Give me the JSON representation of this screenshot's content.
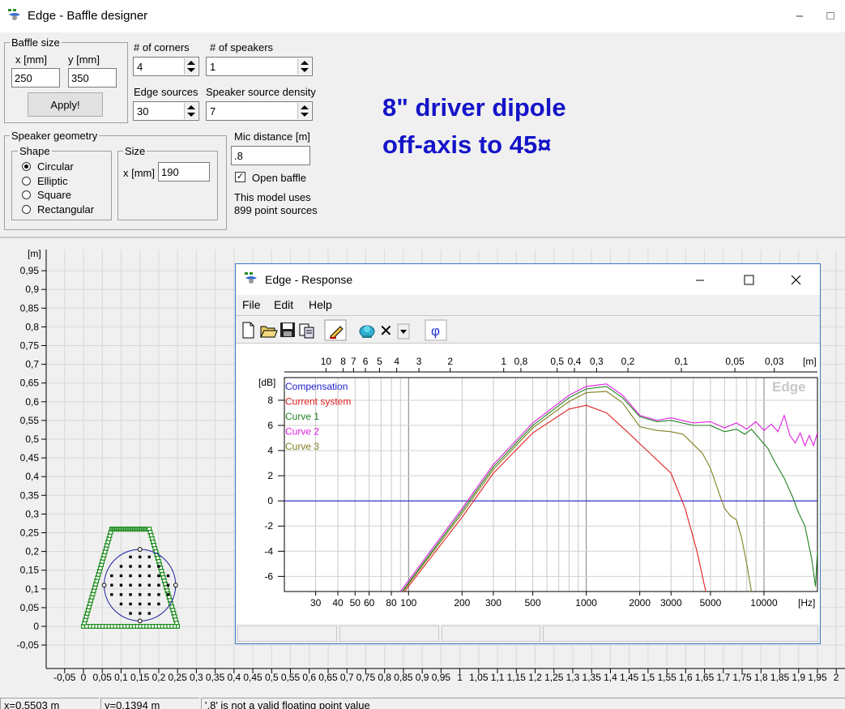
{
  "window": {
    "title": "Edge - Baffle designer",
    "min": "–",
    "max": "□"
  },
  "baffle": {
    "group": "Baffle size",
    "x_label": "x [mm]",
    "y_label": "y [mm]",
    "x_value": "250",
    "y_value": "350",
    "apply": "Apply!"
  },
  "corners": {
    "label": "# of corners",
    "value": "4"
  },
  "speakers": {
    "label": "# of speakers",
    "value": "1"
  },
  "edge_sources": {
    "label": "Edge sources",
    "value": "30"
  },
  "density": {
    "label": "Speaker source density",
    "value": "7"
  },
  "geometry": {
    "group": "Speaker geometry",
    "shape_group": "Shape",
    "shapes": [
      "Circular",
      "Elliptic",
      "Square",
      "Rectangular"
    ],
    "selected": 0,
    "size_group": "Size",
    "size_label": "x [mm]",
    "size_value": "190"
  },
  "mic": {
    "label": "Mic distance [m]",
    "value": ".8"
  },
  "open_baffle": {
    "label": "Open baffle",
    "checked": true
  },
  "model_info": {
    "line1": "This model uses",
    "line2": "899 point sources"
  },
  "banner": {
    "line1": "8\" driver dipole",
    "line2": "off-axis to 45¤"
  },
  "plot": {
    "unit": "[m]",
    "y_ticks": [
      "0,95",
      "0,9",
      "0,85",
      "0,8",
      "0,75",
      "0,7",
      "0,65",
      "0,6",
      "0,55",
      "0,5",
      "0,45",
      "0,4",
      "0,35",
      "0,3",
      "0,25",
      "0,2",
      "0,15",
      "0,1",
      "0,05",
      "0",
      "-0,05"
    ],
    "x_ticks": [
      "-0,05",
      "0",
      "0,05",
      "0,1",
      "0,15",
      "0,2",
      "0,25",
      "0,3",
      "0,35",
      "0,4",
      "0,45",
      "0,5",
      "0,55",
      "0,6",
      "0,65",
      "0,7",
      "0,75",
      "0,8",
      "0,85",
      "0,9",
      "0,95",
      "1",
      "1,05",
      "1,1",
      "1,15",
      "1,2",
      "1,25",
      "1,3",
      "1,35",
      "1,4",
      "1,45",
      "1,5",
      "1,55",
      "1,6",
      "1,65",
      "1,7",
      "1,75",
      "1,8",
      "1,85",
      "1,9",
      "1,95",
      "2"
    ],
    "baffle_color": "#1a8a1a",
    "speaker_color": "#2020a0"
  },
  "status": {
    "x": "x=0,5503 m",
    "y": "y=0,1394 m",
    "msg": "'.8' is not a valid floating point value"
  },
  "response": {
    "title": "Edge - Response",
    "menu": [
      "File",
      "Edit",
      "Help"
    ],
    "toolbar": [
      "new-icon",
      "open-icon",
      "save-icon",
      "copy-icon",
      "pen-icon",
      "speaker-icon",
      "delete-icon",
      "dropdown-icon",
      "phase-icon"
    ],
    "phase_glyph": "φ",
    "delete_glyph": "✕",
    "chart": {
      "top_ticks": [
        "10",
        "8",
        "7",
        "6",
        "5",
        "4",
        "3",
        "2",
        "1",
        "0,8",
        "0,5",
        "0,4",
        "0,3",
        "0,2",
        "0,1",
        "0,05",
        "0,03"
      ],
      "top_unit": "[m]",
      "y_unit": "[dB]",
      "y_ticks": [
        "8",
        "6",
        "4",
        "2",
        "0",
        "-2",
        "-4",
        "-6"
      ],
      "x_ticks": [
        "30",
        "40",
        "50",
        "60",
        "80",
        "100",
        "200",
        "300",
        "500",
        "1000",
        "2000",
        "3000",
        "5000",
        "10000"
      ],
      "x_unit": "[Hz]",
      "watermark": "Edge",
      "legend": [
        {
          "name": "Compensation",
          "color": "#2020d0"
        },
        {
          "name": "Current system",
          "color": "#e02020"
        },
        {
          "name": "Curve 1",
          "color": "#208020"
        },
        {
          "name": "Curve 2",
          "color": "#e020e0"
        },
        {
          "name": "Curve 3",
          "color": "#808020"
        }
      ]
    }
  }
}
